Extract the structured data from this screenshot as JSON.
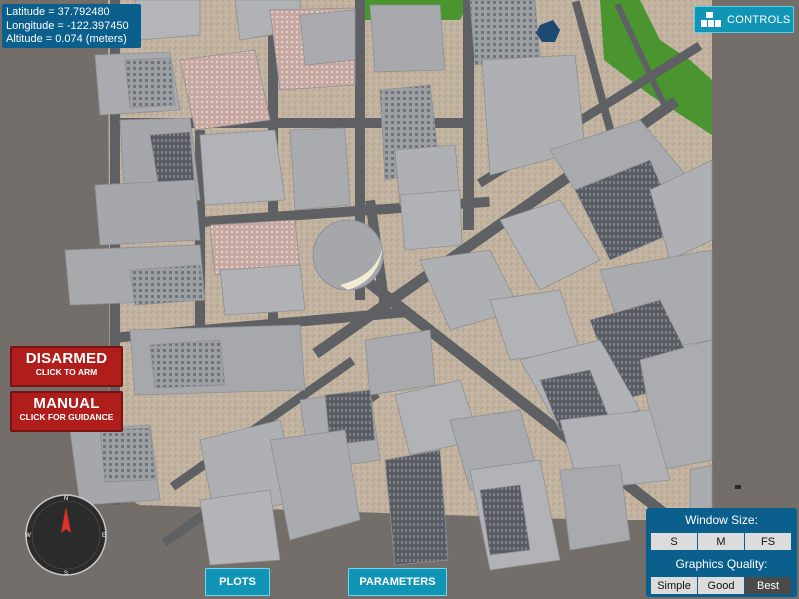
{
  "telemetry": {
    "latitude": "Latitude = 37.792480",
    "longitude": "Longitude = -122.397450",
    "altitude": "Altitude = 0.074 (meters)"
  },
  "controls_button": {
    "label": "CONTROLS",
    "icon": "blocks-icon"
  },
  "arm_button": {
    "title": "DISARMED",
    "subtitle": "CLICK TO ARM"
  },
  "mode_button": {
    "title": "MANUAL",
    "subtitle": "CLICK FOR GUIDANCE"
  },
  "bottom_buttons": {
    "plots": "PLOTS",
    "parameters": "PARAMETERS"
  },
  "settings_panel": {
    "window_size_label": "Window Size:",
    "window_sizes": [
      "S",
      "M",
      "FS"
    ],
    "graphics_label": "Graphics Quality:",
    "graphics_options": [
      "Simple",
      "Good",
      "Best"
    ],
    "selected_graphics": "Best"
  },
  "compass": {
    "labels": [
      "N",
      "E",
      "S",
      "W"
    ],
    "heading_deg": 0
  },
  "colors": {
    "panel": "#0b5f8c",
    "accent_button": "#1195b6",
    "alert_button": "#b01e1c",
    "ground": "#c1b29f",
    "road": "#5e6063",
    "building": "#a9abaf",
    "park": "#4a9530"
  }
}
